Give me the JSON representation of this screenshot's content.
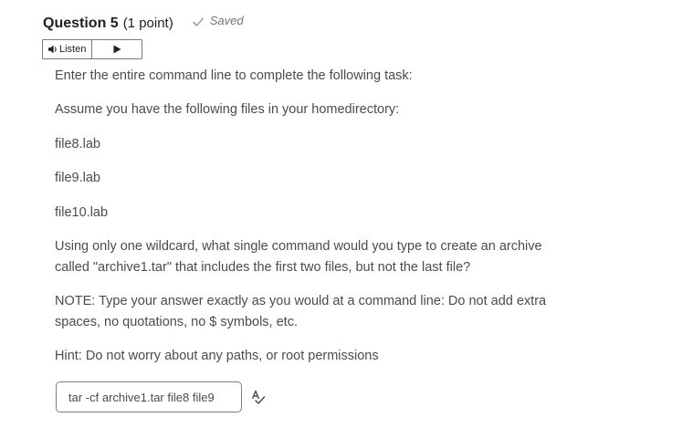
{
  "question": {
    "title": "Question 5",
    "points": "(1 point)",
    "status": "Saved"
  },
  "listen": {
    "label": "Listen"
  },
  "body": {
    "lines": [
      "Enter the entire command line to complete the following task:",
      "Assume you have the following files in your homedirectory:",
      "file8.lab",
      "file9.lab",
      "file10.lab",
      "Using only one wildcard, what single command would you type to create an archive",
      "called \"archive1.tar\" that includes the first two files, but not the last file?",
      "NOTE: Type your answer exactly as you would at a command line:  Do not add extra",
      "spaces, no quotations, no $ symbols, etc.",
      "Hint: Do not worry about any paths, or root permissions"
    ]
  },
  "answer": {
    "value": "tar -cf archive1.tar file8 file9"
  },
  "icons": {
    "saved": "check-icon",
    "listen": "speaker-icon",
    "play": "play-icon",
    "spellcheck": "spellcheck-icon"
  },
  "colors": {
    "text": "#494c4e",
    "title": "#202122",
    "muted": "#6e7376",
    "border": "#7e7e7e"
  }
}
